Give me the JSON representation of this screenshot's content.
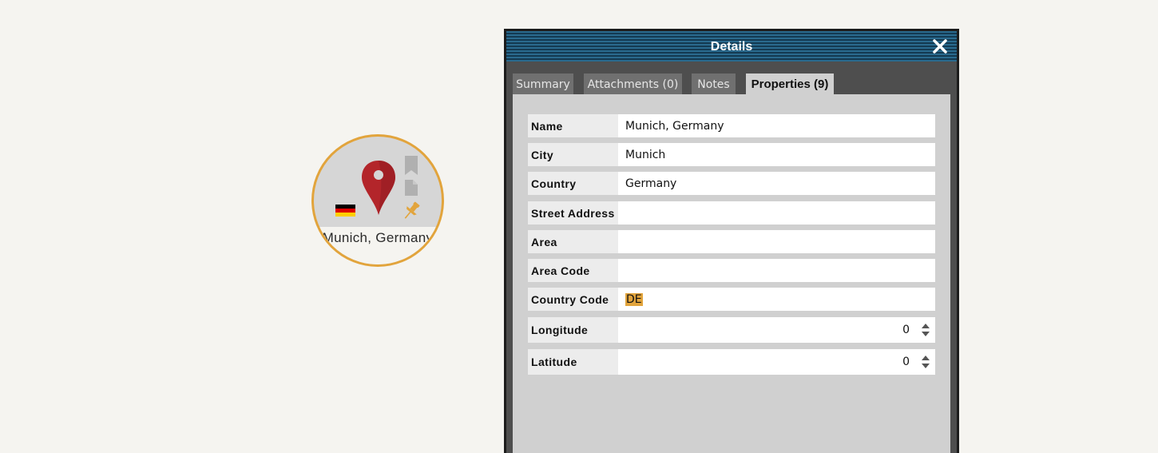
{
  "node": {
    "label": "Munich, Germany",
    "flag_colors": [
      "#000000",
      "#dd0000",
      "#ffce00"
    ],
    "pin_color": "#b3252a",
    "ring_color": "#e2a43c",
    "icons": [
      "map-pin-icon",
      "germany-flag-icon",
      "bookmark-icon",
      "document-icon",
      "pushpin-icon"
    ]
  },
  "panel": {
    "title": "Details",
    "close_icon": "close-icon",
    "tabs": [
      {
        "label": "Summary"
      },
      {
        "label": "Attachments (0)"
      },
      {
        "label": "Notes"
      },
      {
        "label": "Properties (9)"
      }
    ],
    "active_tab": "Properties (9)",
    "properties": [
      {
        "label": "Name",
        "value": "Munich, Germany"
      },
      {
        "label": "City",
        "value": "Munich"
      },
      {
        "label": "Country",
        "value": "Germany"
      },
      {
        "label": "Street Address",
        "value": ""
      },
      {
        "label": "Area",
        "value": ""
      },
      {
        "label": "Area Code",
        "value": ""
      },
      {
        "label": "Country Code",
        "value": "DE"
      },
      {
        "label": "Longitude",
        "value": "0"
      },
      {
        "label": "Latitude",
        "value": "0"
      }
    ]
  },
  "colors": {
    "header_stripe_light": "#2a6a8e",
    "header_stripe_dark": "#143a52",
    "highlight": "#e2a43c"
  }
}
